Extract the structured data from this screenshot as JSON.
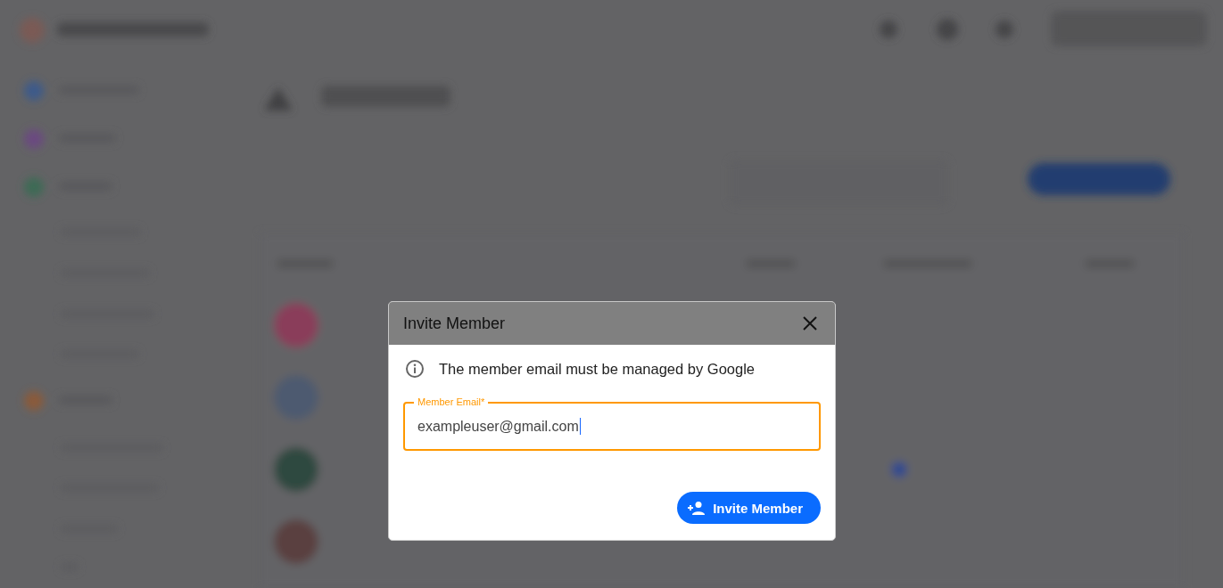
{
  "dialog": {
    "title": "Invite Member",
    "info": "The member email must be managed by Google",
    "field": {
      "label": "Member Email*",
      "value": "exampleuser@gmail.com",
      "focused": true
    },
    "button": "Invite Member"
  }
}
